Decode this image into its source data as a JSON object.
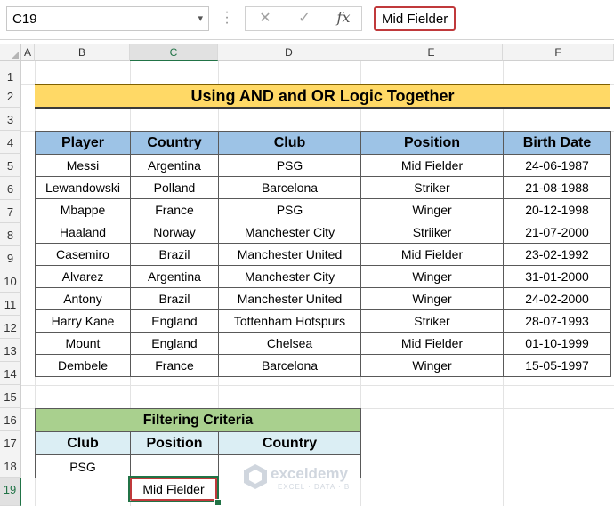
{
  "name_box": {
    "value": "C19"
  },
  "formula_bar": {
    "value": "Mid Fielder",
    "fx_label": "fx",
    "cancel_glyph": "✕",
    "enter_glyph": "✓"
  },
  "columns": [
    "A",
    "B",
    "C",
    "D",
    "E",
    "F"
  ],
  "rows": [
    "1",
    "2",
    "3",
    "4",
    "5",
    "6",
    "7",
    "8",
    "9",
    "10",
    "11",
    "12",
    "13",
    "14",
    "15",
    "16",
    "17",
    "18",
    "19"
  ],
  "title": "Using AND and OR Logic Together",
  "table": {
    "headers": [
      "Player",
      "Country",
      "Club",
      "Position",
      "Birth Date"
    ],
    "rows": [
      [
        "Messi",
        "Argentina",
        "PSG",
        "Mid Fielder",
        "24-06-1987"
      ],
      [
        "Lewandowski",
        "Polland",
        "Barcelona",
        "Striker",
        "21-08-1988"
      ],
      [
        "Mbappe",
        "France",
        "PSG",
        "Winger",
        "20-12-1998"
      ],
      [
        "Haaland",
        "Norway",
        "Manchester City",
        "Striiker",
        "21-07-2000"
      ],
      [
        "Casemiro",
        "Brazil",
        "Manchester United",
        "Mid Fielder",
        "23-02-1992"
      ],
      [
        "Alvarez",
        "Argentina",
        "Manchester City",
        "Winger",
        "31-01-2000"
      ],
      [
        "Antony",
        "Brazil",
        "Manchester United",
        "Winger",
        "24-02-2000"
      ],
      [
        "Harry Kane",
        "England",
        "Tottenham Hotspurs",
        "Striker",
        "28-07-1993"
      ],
      [
        "Mount",
        "England",
        "Chelsea",
        "Mid Fielder",
        "01-10-1999"
      ],
      [
        "Dembele",
        "France",
        "Barcelona",
        "Winger",
        "15-05-1997"
      ]
    ]
  },
  "criteria": {
    "title": "Filtering Criteria",
    "headers": [
      "Club",
      "Position",
      "Country"
    ],
    "row18": [
      "PSG",
      "",
      ""
    ],
    "row19_selected": "Mid Fielder"
  },
  "watermark": {
    "name": "exceldemy",
    "tagline": "EXCEL · DATA · BI"
  },
  "colors": {
    "title_bg": "#ffd966",
    "header_bg": "#9dc3e6",
    "criteria_title_bg": "#a9d08e",
    "criteria_header_bg": "#dbeef4",
    "selection": "#217346",
    "highlight": "#c0393b"
  }
}
